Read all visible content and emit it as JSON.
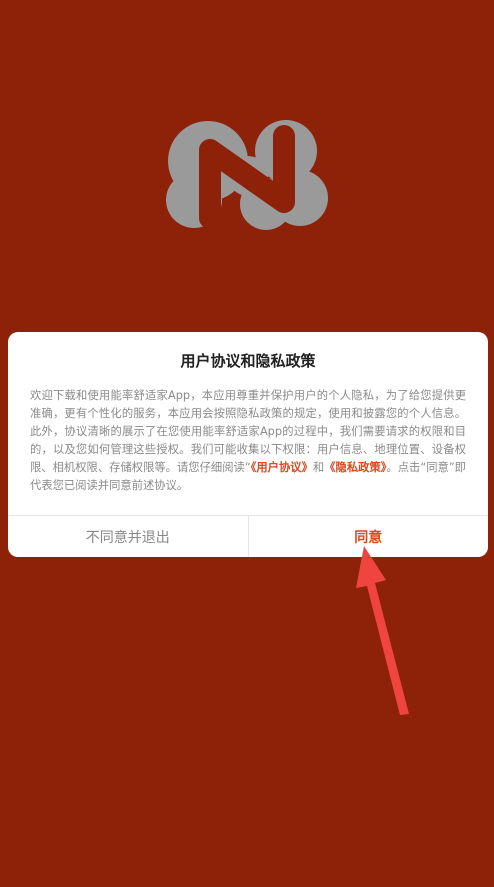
{
  "dialog": {
    "title": "用户协议和隐私政策",
    "body": {
      "text_before": "欢迎下载和使用能率舒适家App，本应用尊重并保护用户的个人隐私，为了给您提供更准确，更有个性化的服务，本应用会按照隐私政策的规定，使用和披露您的个人信息。此外，协议清晰的展示了在您使用能率舒适家App的过程中，我们需要请求的权限和目的，以及您如何管理这些授权。我们可能收集以下权限：用户信息、地理位置、设备权限、相机权限、存储权限等。请您仔细阅读“",
      "user_agreement_link": "《用户协议》",
      "conjunction": "和",
      "privacy_policy_link": "《隐私政策》",
      "text_after": "。点击“同意”即代表您已阅读并同意前述协议。"
    },
    "disagree_label": "不同意并退出",
    "agree_label": "同意"
  },
  "colors": {
    "background": "#8e2209",
    "accent": "#d64a1e",
    "logo": "#9a9a9a",
    "arrow": "#f0453f"
  },
  "icons": {
    "logo": "n-logo-icon",
    "pointer": "red-arrow-icon"
  }
}
